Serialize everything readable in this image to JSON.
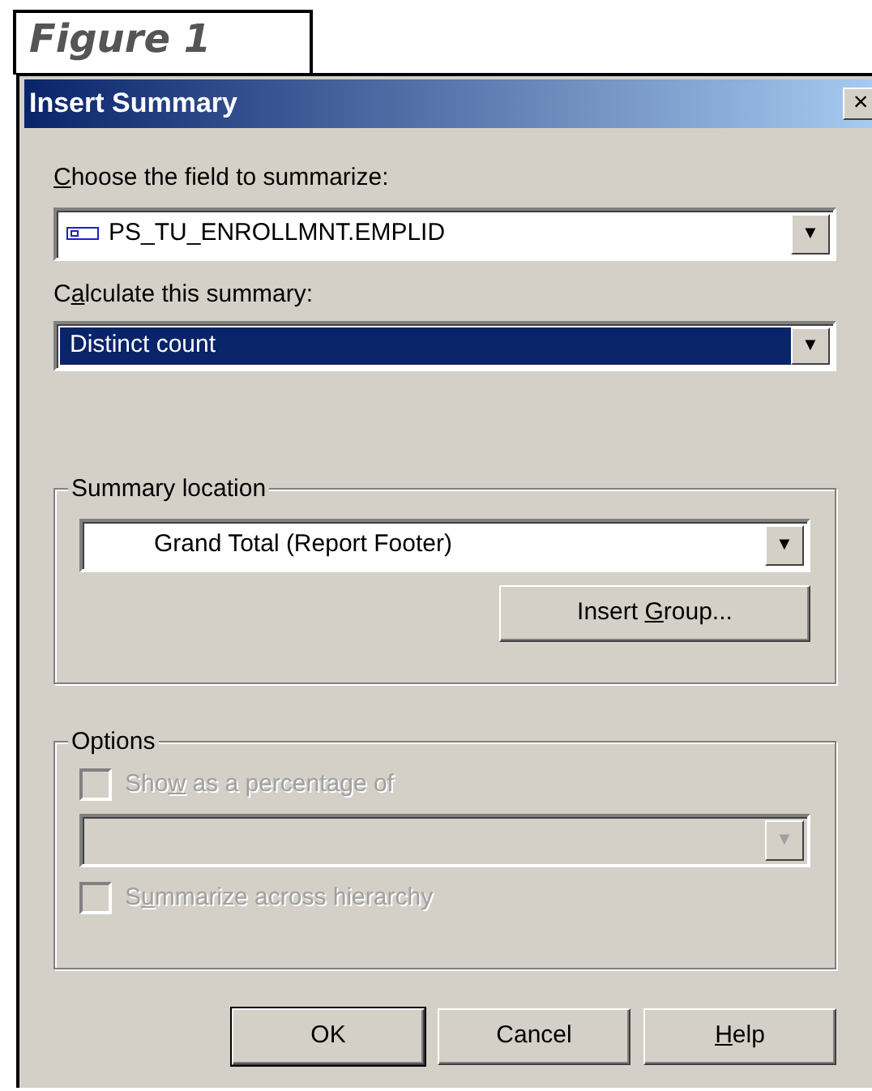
{
  "figure_caption": "Figure 1",
  "window": {
    "title": "Insert Summary",
    "close": "×"
  },
  "field_label": {
    "key": "C",
    "post": "hoose the field to summarize:"
  },
  "field_combo": {
    "value": "PS_TU_ENROLLMNT.EMPLID",
    "selected": false,
    "disabled": false,
    "arrow": "▼"
  },
  "summary_label": {
    "pre": "C",
    "key": "a",
    "post": "lculate this summary:"
  },
  "summary_combo": {
    "value": "Distinct count",
    "selected": true,
    "disabled": false,
    "arrow": "▼"
  },
  "location_group": {
    "title": "Summary location",
    "combo": {
      "value": "Grand Total (Report Footer)",
      "selected": false,
      "disabled": false,
      "arrow": "▼"
    },
    "button": {
      "pre": "Insert ",
      "key": "G",
      "post": "roup..."
    }
  },
  "options_group": {
    "title": "Options",
    "items": [
      {
        "kind": "checkbox",
        "label": {
          "pre": "Sho",
          "key": "w",
          "post": " as a percentage of"
        },
        "checked": false,
        "disabled": true
      },
      {
        "kind": "combo",
        "arrow": "▼",
        "disabled": true
      },
      {
        "kind": "checkbox",
        "label": {
          "pre": "S",
          "key": "u",
          "post": "mmarize across hierarchy"
        },
        "checked": false,
        "disabled": true
      }
    ]
  },
  "buttons": [
    {
      "label": {
        "post": "OK"
      },
      "default": true
    },
    {
      "label": {
        "post": "Cancel"
      },
      "default": false
    },
    {
      "label": {
        "key": "H",
        "post": "elp"
      },
      "default": false
    }
  ]
}
